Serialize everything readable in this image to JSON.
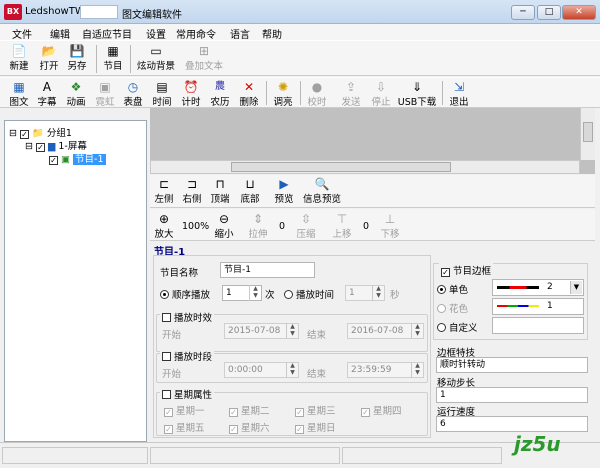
{
  "window": {
    "app_name": "LedshowTW",
    "doc_title": "图文编辑软件",
    "min": "─",
    "max": "□",
    "close": "✕"
  },
  "menu": [
    "文件",
    "编辑",
    "自适应节目",
    "设置",
    "常用命令",
    "语言",
    "帮助"
  ],
  "toolbar1": [
    "新建",
    "打开",
    "另存",
    "节目",
    "炫动背景",
    "叠加文本"
  ],
  "toolbar2": [
    "图文",
    "字幕",
    "动画",
    "霓虹",
    "表盘",
    "时间",
    "计时",
    "农历",
    "删除",
    "调亮",
    "校时",
    "发送",
    "停止",
    "USB下载",
    "退出"
  ],
  "tree": {
    "group": "分组1",
    "screen": "1-屏幕",
    "program": "节目-1"
  },
  "align_bar": [
    "左侧",
    "右侧",
    "顶端",
    "底部",
    "预览",
    "信息预览"
  ],
  "zoom_bar": {
    "zoom_in": "放大",
    "zoom_value": "100%",
    "zoom_out": "缩小",
    "stretch": "拉伸",
    "stretch_val": "0",
    "compress": "压缩",
    "up": "上移",
    "move_val": "0",
    "down": "下移"
  },
  "program": {
    "header": "节目-1",
    "name_label": "节目名称",
    "name_value": "节目-1",
    "seq_play": "顺序播放",
    "seq_value": "1",
    "times_unit": "次",
    "play_time": "播放时间",
    "play_time_value": "1",
    "sec_unit": "秒",
    "play_period_effect": "播放时效",
    "start": "开始",
    "start_date": "2015-07-08",
    "end": "结束",
    "end_date": "2016-07-08",
    "play_time_slot": "播放时段",
    "start_time": "0:00:00",
    "end_time": "23:59:59",
    "week_attr": "星期属性",
    "weekdays": [
      "星期一",
      "星期二",
      "星期三",
      "星期四",
      "星期五",
      "星期六",
      "星期日"
    ]
  },
  "border": {
    "title": "节目边框",
    "single": "单色",
    "single_value": "2",
    "colorful": "花色",
    "colorful_value": "1",
    "custom": "自定义",
    "effect_label": "边框特技",
    "effect_value": "顺时针转动",
    "step_label": "移动步长",
    "step_value": "1",
    "speed_label": "运行速度",
    "speed_value": "6"
  },
  "watermark": "jz5u"
}
